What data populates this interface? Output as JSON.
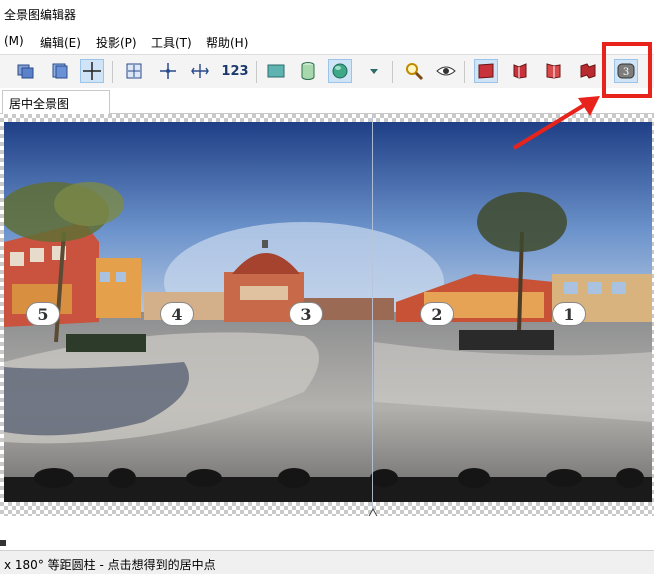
{
  "window": {
    "title": "全景图编辑器"
  },
  "menu": [
    {
      "label": "(M)"
    },
    {
      "label": "编辑(E)"
    },
    {
      "label": "投影(P)"
    },
    {
      "label": "工具(T)"
    },
    {
      "label": "帮助(H)"
    }
  ],
  "toolbar": {
    "numbers_label": "123"
  },
  "tabs": [
    {
      "label": "居中全景图"
    }
  ],
  "markers": [
    "5",
    "4",
    "3",
    "2",
    "1"
  ],
  "status": {
    "text": "x 180° 等距圆柱 - 点击想得到的居中点"
  },
  "colors": {
    "highlight": "#e8231c",
    "active_button": "#cfe4f7"
  }
}
